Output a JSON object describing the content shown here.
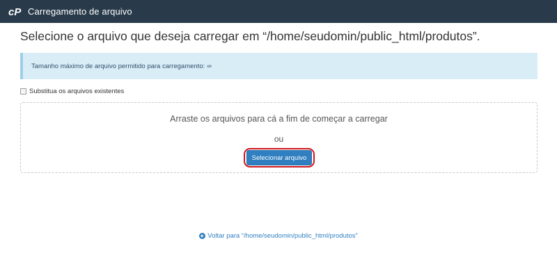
{
  "header": {
    "logo_text": "cP",
    "title": "Carregamento de arquivo"
  },
  "main": {
    "title": "Selecione o arquivo que deseja carregar em “/home/seudomin/public_html/produtos”.",
    "info": {
      "label": "Tamanho máximo de arquivo permitido para carregamento:",
      "value": "∞"
    },
    "overwrite_checkbox": {
      "label": "Substitua os arquivos existentes",
      "checked": false
    },
    "drop_zone": {
      "text": "Arraste os arquivos para cá a fim de começar a carregar",
      "or_text": "ou",
      "button_label": "Selecionar arquivo"
    },
    "back_link": {
      "label": "Voltar para “/home/seudomin/public_html/produtos”",
      "icon": "arrow-left-circle-icon"
    }
  },
  "colors": {
    "topbar": "#293a4a",
    "info_bg": "#d9edf7",
    "primary": "#2f7fc1",
    "highlight": "#d0161b"
  }
}
